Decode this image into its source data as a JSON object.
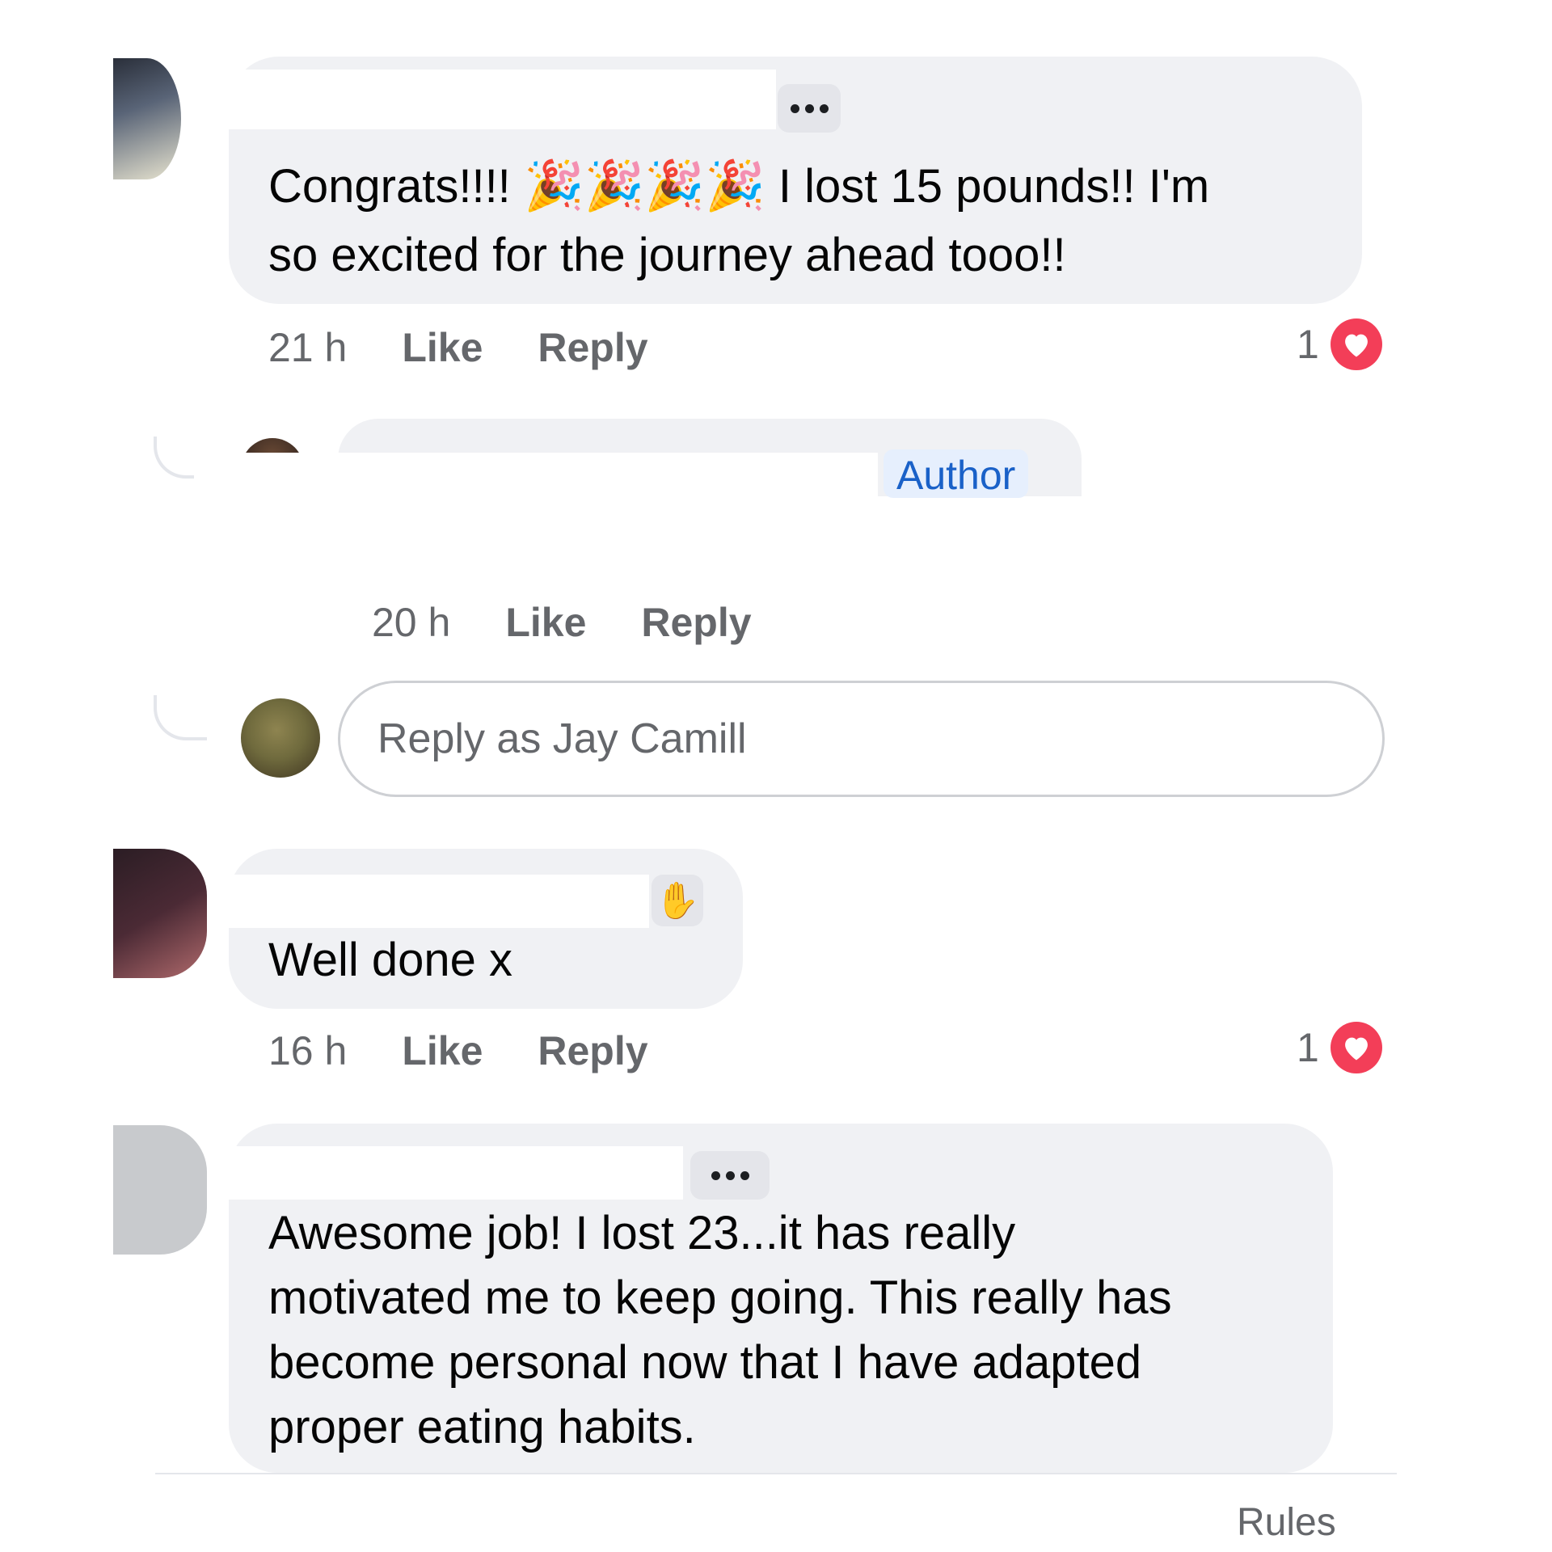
{
  "colors": {
    "bubble": "#f0f1f4",
    "meta_text": "#65676b",
    "heart": "#f33e58",
    "author_badge_bg": "#e6effd",
    "author_badge_text": "#1a61c8"
  },
  "comments": [
    {
      "text_line1_start": "Congrats!!!!",
      "emoji": "🎉🎉🎉🎉",
      "emoji_icon": "party-popper-icon",
      "text_line1_end": "I lost 15 pounds!! I'm",
      "text_line2": "so excited for the journey ahead tooo!!",
      "time": "21 h",
      "like_label": "Like",
      "reply_label": "Reply",
      "reaction_count": "1",
      "reaction_icon": "heart-icon"
    },
    {
      "badge": "Author",
      "time": "20 h",
      "like_label": "Like",
      "reply_label": "Reply"
    },
    {
      "text": "Well done x",
      "badge_icon": "waving-hand-icon",
      "time": "16 h",
      "like_label": "Like",
      "reply_label": "Reply",
      "reaction_count": "1",
      "reaction_icon": "heart-icon"
    },
    {
      "text_lines": [
        "Awesome job!  I lost 23...it has really",
        "motivated me to keep going.  This really has",
        "become personal now that I have adapted",
        "proper eating habits."
      ]
    }
  ],
  "reply_input": {
    "placeholder": "Reply as Jay Camill"
  },
  "footer": {
    "rules_label": "Rules"
  }
}
